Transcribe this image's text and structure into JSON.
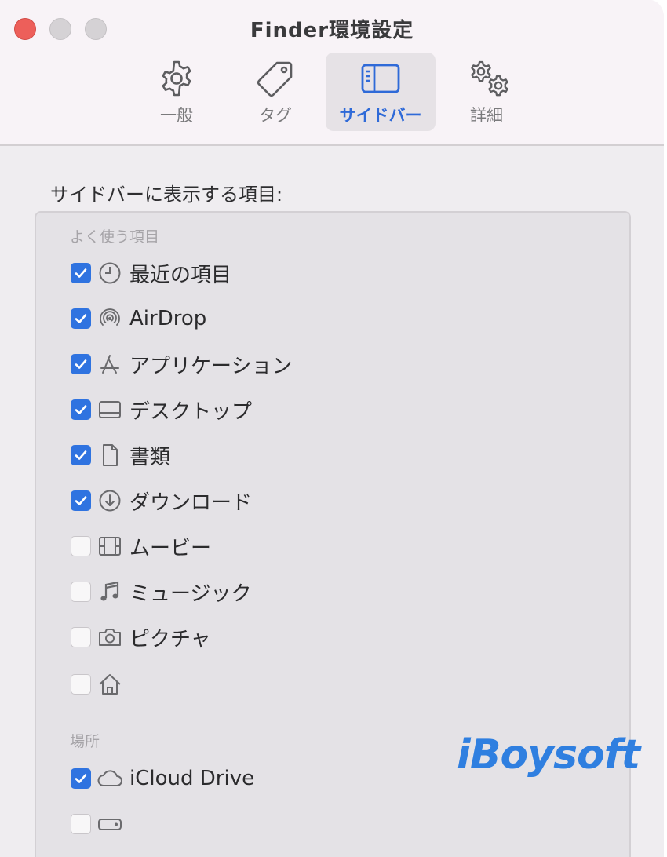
{
  "window": {
    "title": "Finder環境設定"
  },
  "toolbar": {
    "tabs": [
      {
        "label": "一般",
        "icon": "gear-icon"
      },
      {
        "label": "タグ",
        "icon": "tag-icon"
      },
      {
        "label": "サイドバー",
        "icon": "sidebar-icon",
        "selected": true
      },
      {
        "label": "詳細",
        "icon": "gears-icon"
      }
    ]
  },
  "section": {
    "heading": "サイドバーに表示する項目:"
  },
  "groups": {
    "favorites": "よく使う項目",
    "locations": "場所"
  },
  "items": [
    {
      "label": "最近の項目",
      "checked": true,
      "icon": "clock-icon"
    },
    {
      "label": "AirDrop",
      "checked": true,
      "icon": "airdrop-icon"
    },
    {
      "label": "アプリケーション",
      "checked": true,
      "icon": "applications-icon"
    },
    {
      "label": "デスクトップ",
      "checked": true,
      "icon": "desktop-icon"
    },
    {
      "label": "書類",
      "checked": true,
      "icon": "document-icon"
    },
    {
      "label": "ダウンロード",
      "checked": true,
      "icon": "download-icon"
    },
    {
      "label": "ムービー",
      "checked": false,
      "icon": "film-icon"
    },
    {
      "label": "ミュージック",
      "checked": false,
      "icon": "music-note-icon"
    },
    {
      "label": "ピクチャ",
      "checked": false,
      "icon": "camera-icon"
    },
    {
      "label": "",
      "checked": false,
      "icon": "home-icon"
    }
  ],
  "location_items": [
    {
      "label": "iCloud Drive",
      "checked": true,
      "icon": "cloud-icon"
    },
    {
      "label": "",
      "checked": false,
      "icon": "drive-icon"
    }
  ],
  "watermark": "iBoysoft",
  "colors": {
    "accent": "#2f73e0",
    "close_button": "#ed5f5a"
  }
}
